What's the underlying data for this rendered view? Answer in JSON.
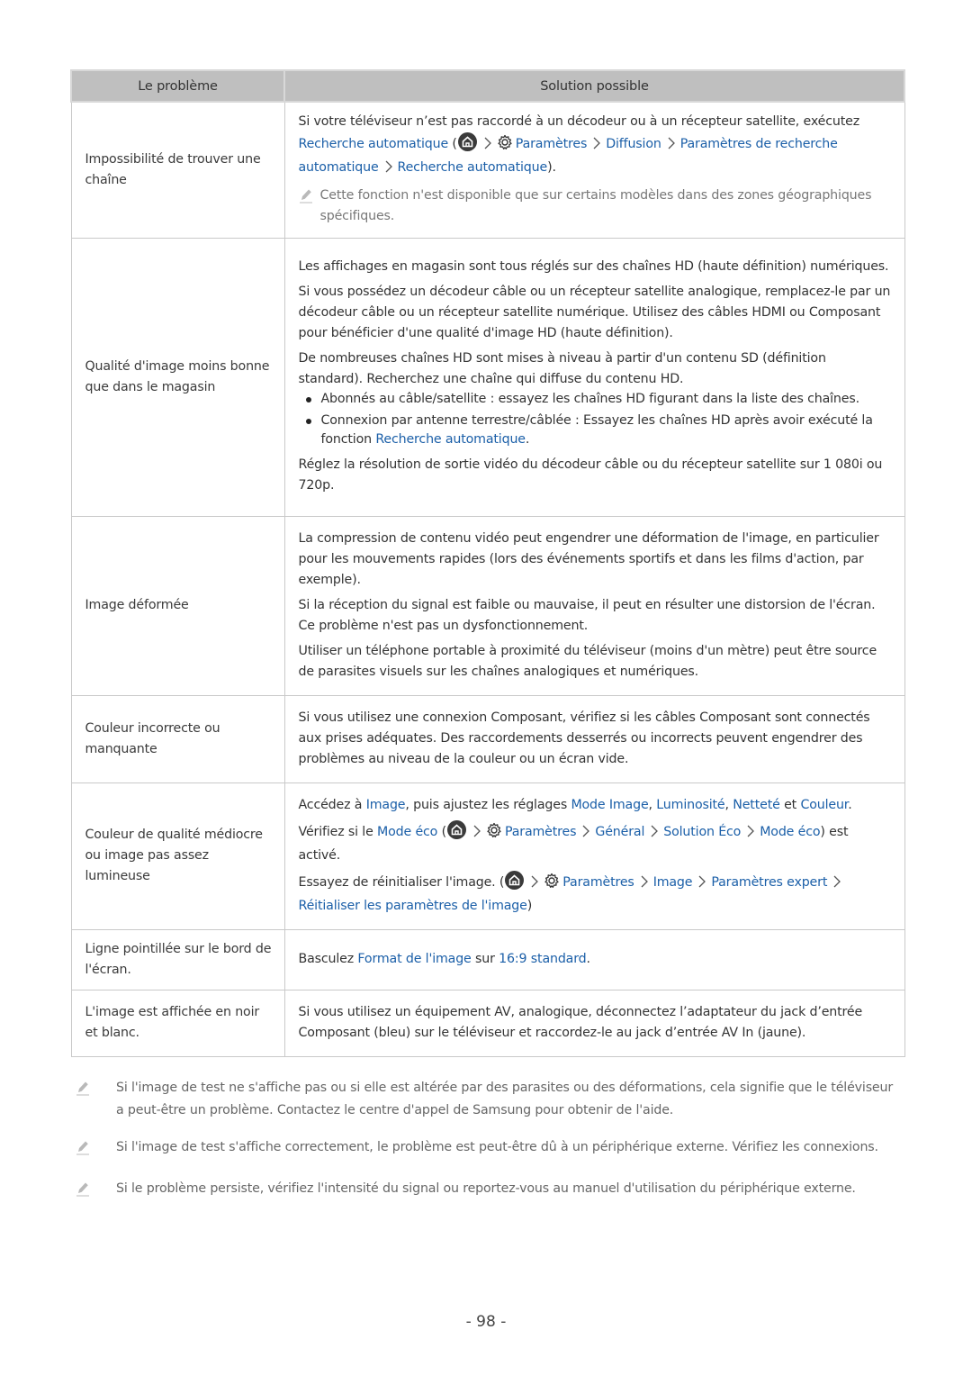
{
  "table": {
    "header": {
      "problem": "Le problème",
      "solution": "Solution possible"
    },
    "rows": [
      {
        "problem": "Impossibilité de trouver une chaîne",
        "intro": "Si votre téléviseur n’est pas raccordé à un décodeur ou à un récepteur satellite, exécutez",
        "link_main": "Recherche automatique",
        "path": [
          "Paramètres",
          "Diffusion",
          "Paramètres de recherche automatique",
          "Recherche automatique"
        ],
        "close": ").",
        "note": "Cette fonction n'est disponible que sur certains modèles dans des zones géographiques spécifiques."
      },
      {
        "problem": "Qualité d'image moins bonne que dans le magasin",
        "p1": "Les affichages en magasin sont tous réglés sur des chaînes HD (haute définition) numériques.",
        "p2": "Si vous possédez un décodeur câble ou un récepteur satellite analogique, remplacez-le par un décodeur câble ou un récepteur satellite numérique. Utilisez des câbles HDMI ou Composant pour bénéficier d'une qualité d'image HD (haute définition).",
        "p3": "De nombreuses chaînes HD sont mises à niveau à partir d'un contenu SD (définition standard). Recherchez une chaîne qui diffuse du contenu HD.",
        "bullet1": "Abonnés au câble/satellite : essayez les chaînes HD figurant dans la liste des chaînes.",
        "bullet2_text": "Connexion par antenne terrestre/câblée : Essayez les chaînes HD après avoir exécuté la fonction",
        "bullet2_link": "Recherche automatique",
        "bullet2_end": ".",
        "p4": "Réglez la résolution de sortie vidéo du décodeur câble ou du récepteur satellite sur 1 080i ou 720p."
      },
      {
        "problem": "Image déformée",
        "p1": "La compression de contenu vidéo peut engendrer une déformation de l'image, en particulier pour les mouvements rapides (lors des événements sportifs et dans les films d'action, par exemple).",
        "p2": "Si la réception du signal est faible ou mauvaise, il peut en résulter une distorsion de l'écran. Ce problème n'est pas un dysfonctionnement.",
        "p3": "Utiliser un téléphone portable à proximité du téléviseur (moins d'un mètre) peut être source de parasites visuels sur les chaînes analogiques et numériques."
      },
      {
        "problem": "Couleur incorrecte ou manquante",
        "p1": "Si vous utilisez une connexion Composant, vérifiez si les câbles Composant sont connectés aux prises adéquates. Des raccordements desserrés ou incorrects peuvent engendrer des problèmes au niveau de la couleur ou un écran vide."
      },
      {
        "problem": "Couleur de qualité médiocre ou image pas assez lumineuse",
        "l1_a": "Accédez à",
        "l1_link1": "Image",
        "l1_b": ", puis ajustez les réglages",
        "l1_link2": "Mode Image",
        "l1_sep1": ",",
        "l1_link3": "Luminosité",
        "l1_sep2": ",",
        "l1_link4": "Netteté",
        "l1_c": "et",
        "l1_link5": "Couleur",
        "l1_end": ".",
        "l2_a": "Vérifiez si le",
        "l2_link": "Mode éco",
        "l2_path": [
          "Paramètres",
          "Général",
          "Solution Éco",
          "Mode éco"
        ],
        "l2_end": ") est activé.",
        "l3_a": "Essayez de réinitialiser l'image. (",
        "l3_path": [
          "Paramètres",
          "Image",
          "Paramètres expert",
          "Réitialiser les paramètres de l'image"
        ],
        "l3_end": ")"
      },
      {
        "problem": "Ligne pointillée sur le bord de l'écran.",
        "a": "Basculez",
        "link1": "Format de l'image",
        "b": "sur",
        "link2": "16:9 standard",
        "end": "."
      },
      {
        "problem": "L'image est affichée en noir et blanc.",
        "p1": "Si vous utilisez un équipement AV, analogique, déconnectez l’adaptateur du jack d’entrée Composant (bleu) sur le téléviseur et raccordez-le au jack d’entrée AV In (jaune)."
      }
    ]
  },
  "footnotes": [
    "Si l'image de test ne s'affiche pas ou si elle est altérée par des parasites ou des déformations, cela signifie que le téléviseur a peut-être un problème. Contactez le centre d'appel de Samsung pour obtenir de l'aide.",
    "Si l'image de test s'affiche correctement, le problème est peut-être dû à un périphérique externe. Vérifiez les connexions.",
    "Si le problème persiste, vérifiez l'intensité du signal ou reportez-vous au manuel d'utilisation du périphérique externe."
  ],
  "page_number": "- 98 -",
  "colors": {
    "link": "#1b5fa8",
    "header_bg": "#bfbfbf",
    "note_text": "#777777"
  }
}
